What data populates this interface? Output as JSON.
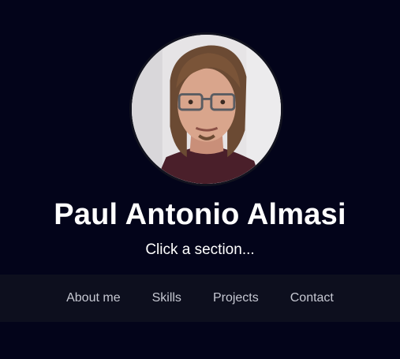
{
  "profile": {
    "name": "Paul Antonio Almasi",
    "subtitle": "Click a section...",
    "avatar_icon": "profile-photo"
  },
  "nav": {
    "items": [
      {
        "label": "About me"
      },
      {
        "label": "Skills"
      },
      {
        "label": "Projects"
      },
      {
        "label": "Contact"
      }
    ]
  },
  "colors": {
    "background": "#03041a",
    "nav_background": "#0d0f1e",
    "text": "#ffffff",
    "nav_text": "#c6c8d2"
  }
}
